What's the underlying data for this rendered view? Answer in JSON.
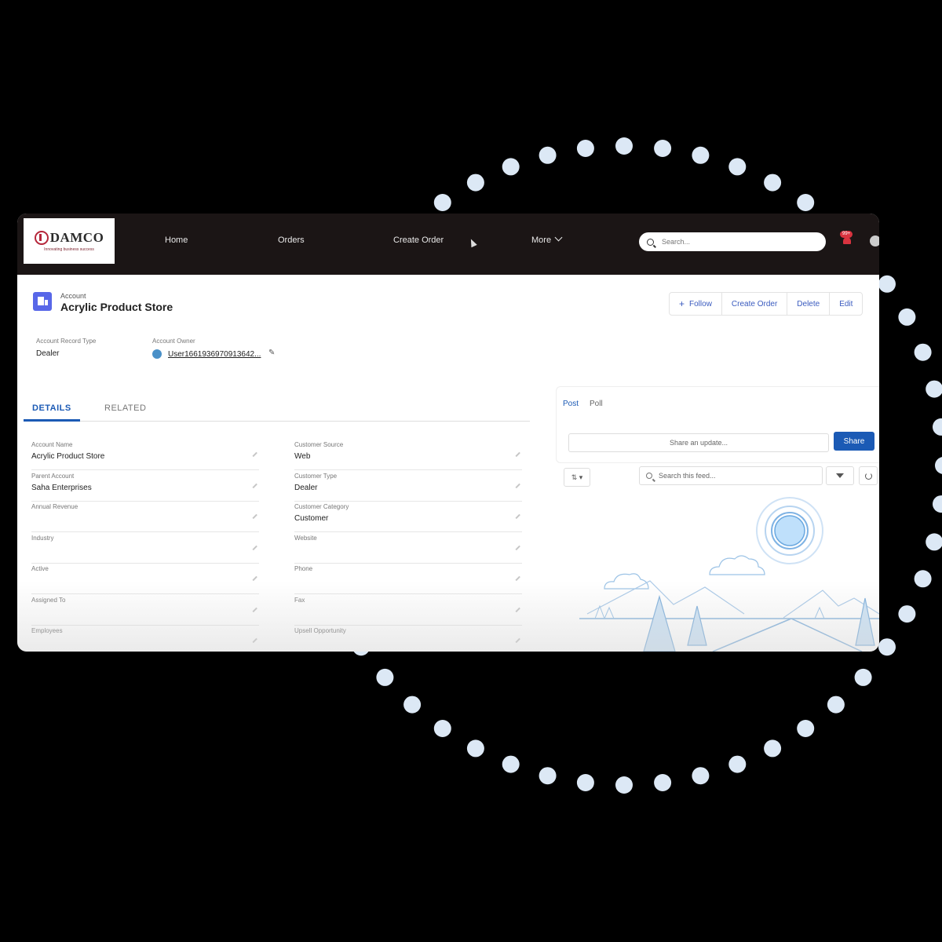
{
  "brand": {
    "name": "DAMCO",
    "tagline": "Innovating business success"
  },
  "nav": {
    "items": [
      {
        "label": "Home"
      },
      {
        "label": "Orders"
      },
      {
        "label": "Create Order"
      },
      {
        "label": "More"
      }
    ],
    "search_placeholder": "Search...",
    "notification_count": "99+"
  },
  "record": {
    "object_label": "Account",
    "title": "Acrylic Product Store",
    "actions": {
      "follow": "Follow",
      "create_order": "Create Order",
      "delete": "Delete",
      "edit": "Edit"
    },
    "highlights": {
      "record_type_label": "Account Record Type",
      "record_type_value": "Dealer",
      "owner_label": "Account Owner",
      "owner_value": "User1661936970913642..."
    }
  },
  "tabs": {
    "details": "DETAILS",
    "related": "RELATED"
  },
  "fields": {
    "left": [
      {
        "label": "Account Name",
        "value": "Acrylic Product Store"
      },
      {
        "label": "Parent Account",
        "value": "Saha Enterprises"
      },
      {
        "label": "Annual Revenue",
        "value": ""
      },
      {
        "label": "Industry",
        "value": ""
      },
      {
        "label": "Active",
        "value": ""
      },
      {
        "label": "Assigned To",
        "value": ""
      },
      {
        "label": "Employees",
        "value": ""
      }
    ],
    "right": [
      {
        "label": "Customer Source",
        "value": "Web"
      },
      {
        "label": "Customer Type",
        "value": "Dealer"
      },
      {
        "label": "Customer Category",
        "value": "Customer"
      },
      {
        "label": "Website",
        "value": ""
      },
      {
        "label": "Phone",
        "value": ""
      },
      {
        "label": "Fax",
        "value": ""
      },
      {
        "label": "Upsell Opportunity",
        "value": ""
      }
    ]
  },
  "feed": {
    "tab_post": "Post",
    "tab_poll": "Poll",
    "share_placeholder": "Share an update...",
    "share_button": "Share",
    "sort_label": "⇅ ▾",
    "search_placeholder": "Search this feed..."
  },
  "colors": {
    "topbar": "#1b1515",
    "accent": "#1b5ab5",
    "record_icon": "#5867e8",
    "dots": "#dce8f5",
    "illustration": "#9cc3e6"
  }
}
